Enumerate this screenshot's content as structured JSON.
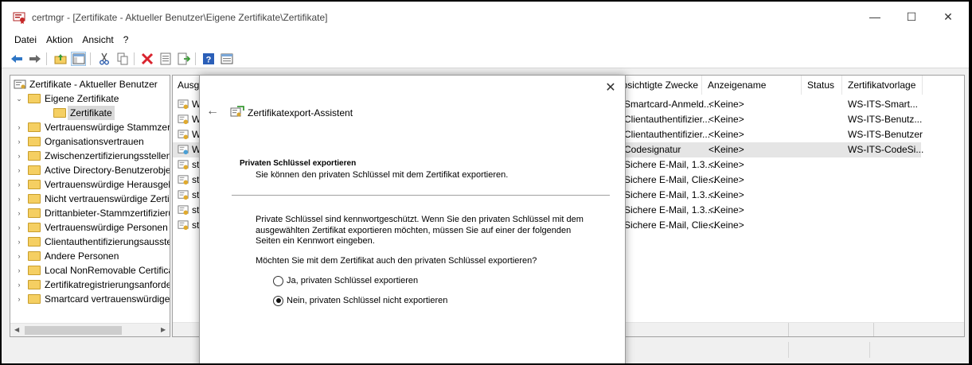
{
  "window": {
    "title": "certmgr - [Zertifikate - Aktueller Benutzer\\Eigene Zertifikate\\Zertifikate]",
    "minimize_glyph": "—",
    "maximize_glyph": "☐",
    "close_glyph": "✕"
  },
  "menu": [
    "Datei",
    "Aktion",
    "Ansicht",
    "?"
  ],
  "toolbar": {
    "icons": [
      "back-icon",
      "forward-icon",
      "up-folder-icon",
      "show-hide-tree-icon",
      "cut-icon",
      "copy-icon",
      "delete-icon",
      "properties-icon",
      "export-list-icon",
      "help-icon",
      "mmc-view-icon"
    ]
  },
  "tree": {
    "root": "Zertifikate - Aktueller Benutzer",
    "items": [
      {
        "label": "Eigene Zertifikate",
        "expander": "⌄"
      },
      {
        "label": "Zertifikate",
        "expander": ""
      },
      {
        "label": "Vertrauenswürdige Stammzertifizierungsstellen",
        "expander": "›"
      },
      {
        "label": "Organisationsvertrauen",
        "expander": "›"
      },
      {
        "label": "Zwischenzertifizierungsstellen",
        "expander": "›"
      },
      {
        "label": "Active Directory-Benutzerobjekt",
        "expander": "›"
      },
      {
        "label": "Vertrauenswürdige Herausgeber",
        "expander": "›"
      },
      {
        "label": "Nicht vertrauenswürdige Zertifikate",
        "expander": "›"
      },
      {
        "label": "Drittanbieter-Stammzertifizierungsstellen",
        "expander": "›"
      },
      {
        "label": "Vertrauenswürdige Personen",
        "expander": "›"
      },
      {
        "label": "Clientauthentifizierungsaussteller",
        "expander": "›"
      },
      {
        "label": "Andere Personen",
        "expander": "›"
      },
      {
        "label": "Local NonRemovable Certificates",
        "expander": "›"
      },
      {
        "label": "Zertifikatregistrierungsanforderungen",
        "expander": "›"
      },
      {
        "label": "Smartcard vertrauenswürdige Stämme",
        "expander": "›"
      }
    ]
  },
  "list": {
    "columns": [
      "Ausg",
      "Beabsichtigte Zwecke",
      "Anzeigename",
      "Status",
      "Zertifikatvorlage"
    ],
    "rows": [
      {
        "name": "W",
        "purpose": "Smartcard-Anmeld...",
        "display": "<Keine>",
        "status": "",
        "template": "WS-ITS-Smart...",
        "highlight": false
      },
      {
        "name": "W",
        "purpose": "Clientauthentifizier...",
        "display": "<Keine>",
        "status": "",
        "template": "WS-ITS-Benutz...",
        "highlight": false
      },
      {
        "name": "W",
        "purpose": "Clientauthentifizier...",
        "display": "<Keine>",
        "status": "",
        "template": "WS-ITS-Benutzer",
        "highlight": false
      },
      {
        "name": "W",
        "purpose": "Codesignatur",
        "display": "<Keine>",
        "status": "",
        "template": "WS-ITS-CodeSi...",
        "highlight": true
      },
      {
        "name": "st",
        "purpose": "Sichere E-Mail, 1.3....",
        "display": "<Keine>",
        "status": "",
        "template": "",
        "highlight": false
      },
      {
        "name": "st",
        "purpose": "Sichere E-Mail, Clie...",
        "display": "<Keine>",
        "status": "",
        "template": "",
        "highlight": false
      },
      {
        "name": "st",
        "purpose": "Sichere E-Mail, 1.3....",
        "display": "<Keine>",
        "status": "",
        "template": "",
        "highlight": false
      },
      {
        "name": "st",
        "purpose": "Sichere E-Mail, 1.3....",
        "display": "<Keine>",
        "status": "",
        "template": "",
        "highlight": false
      },
      {
        "name": "st",
        "purpose": "Sichere E-Mail, Clie...",
        "display": "<Keine>",
        "status": "",
        "template": "",
        "highlight": false
      }
    ]
  },
  "dialog": {
    "close_glyph": "✕",
    "back_glyph": "←",
    "title": "Zertifikatexport-Assistent",
    "heading": "Privaten Schlüssel exportieren",
    "subheading": "Sie können den privaten Schlüssel mit dem Zertifikat exportieren.",
    "description": "Private Schlüssel sind kennwortgeschützt. Wenn Sie den privaten Schlüssel mit dem ausgewählten Zertifikat exportieren möchten, müssen Sie auf einer der folgenden Seiten ein Kennwort eingeben.",
    "question": "Möchten Sie mit dem Zertifikat auch den privaten Schlüssel exportieren?",
    "options": [
      {
        "label": "Ja, privaten Schlüssel exportieren",
        "checked": false
      },
      {
        "label": "Nein, privaten Schlüssel nicht exportieren",
        "checked": true
      }
    ]
  },
  "colors": {
    "selection_gray": "#d9d9d9",
    "highlight_row": "#e5e5e5",
    "folder_yellow": "#f5cf62",
    "delete_red": "#d9232e",
    "help_blue": "#2b5fb8"
  }
}
